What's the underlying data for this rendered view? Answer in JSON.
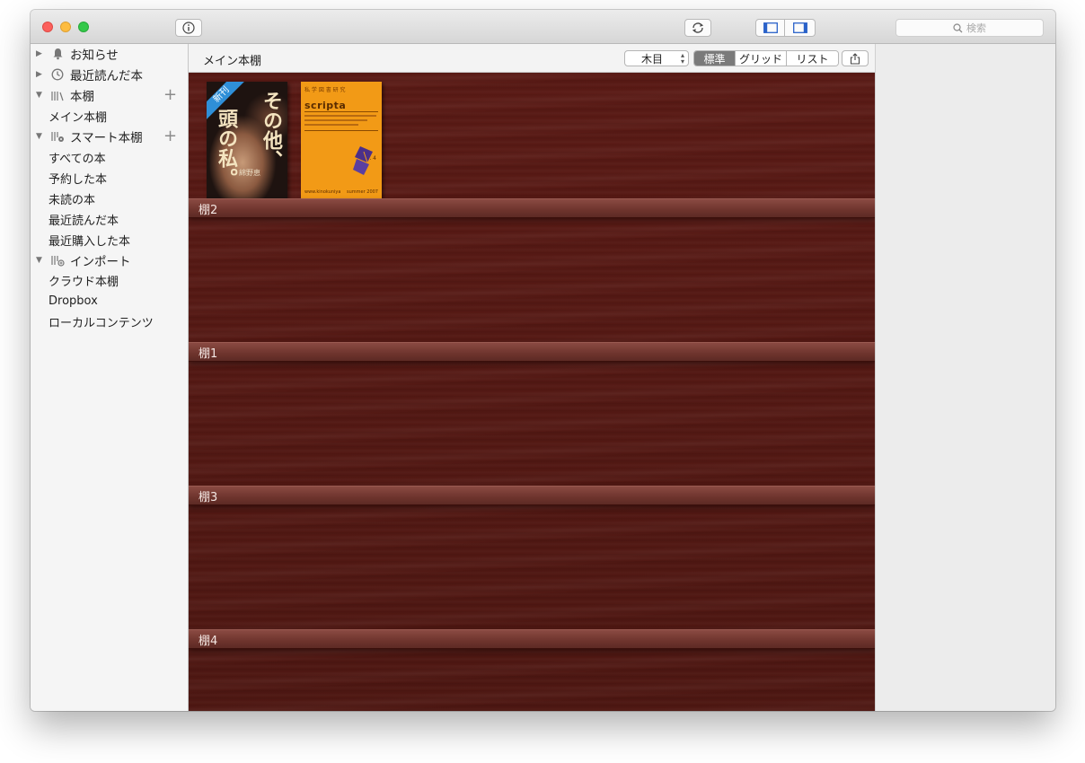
{
  "search": {
    "placeholder": "検索"
  },
  "sidebar": {
    "notifications": "お知らせ",
    "recently_read": "最近読んだ本",
    "bookshelves": {
      "label": "本棚",
      "items": [
        "メイン本棚"
      ]
    },
    "smart_shelves": {
      "label": "スマート本棚",
      "items": [
        "すべての本",
        "予約した本",
        "未読の本",
        "最近読んだ本",
        "最近購入した本"
      ]
    },
    "import": {
      "label": "インポート",
      "items": [
        "クラウド本棚",
        "Dropbox",
        "ローカルコンテンツ"
      ]
    }
  },
  "main": {
    "title": "メイン本棚",
    "sort": {
      "selected": "木目"
    },
    "view_modes": [
      "標準",
      "グリッド",
      "リスト"
    ],
    "active_view": "標準"
  },
  "shelves": [
    {
      "label": ""
    },
    {
      "label": "棚2"
    },
    {
      "label": "棚1"
    },
    {
      "label": "棚3"
    },
    {
      "label": "棚4"
    }
  ],
  "books": [
    {
      "badge": "新刊",
      "cover_text_a": "その他、",
      "cover_text_b": "頭の私。",
      "author": "綿野恵"
    },
    {
      "cover_series": "私 学 図 書 研 究",
      "cover_title": "scripta",
      "cover_issue": "no. 4",
      "cover_footer_left": "www.kinokuniya",
      "cover_footer_right": "summer 2007"
    }
  ],
  "colors": {
    "wood_base": "#4e1712",
    "shelf_board": "#7a3d35",
    "orange_book": "#f29a16",
    "new_badge": "#2f8fd8"
  }
}
